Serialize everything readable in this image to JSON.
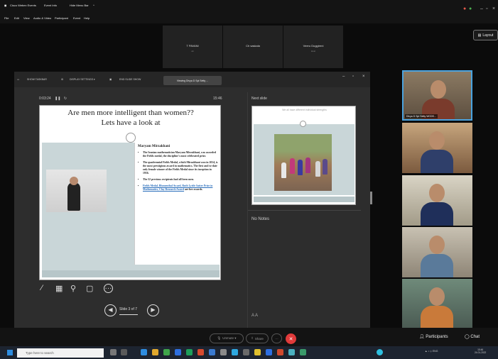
{
  "titlebar": {
    "items": [
      "Cisco Webex Events",
      "Event Info",
      "Hide Menu Bar"
    ],
    "chevron": "^"
  },
  "menubar": {
    "items": [
      "File",
      "Edit",
      "View",
      "Audio & Video",
      "Participant",
      "Event",
      "Help"
    ]
  },
  "participants_strip": [
    {
      "name": "T PAVANI",
      "sub": "ok"
    },
    {
      "name": "Ch saskala",
      "sub": ""
    },
    {
      "name": "Veeru Duggireni",
      "sub": "Host"
    }
  ],
  "layout_button": "Layout",
  "presenter_toolbar": {
    "show_taskbar": "SHOW TASKBAR",
    "display_settings": "DISPLAY SETTINGS ▾",
    "end_slide_show": "END SLIDE SHOW",
    "viewing": "Viewing Divya D Spl Setty ..."
  },
  "timer": "0:03:24",
  "clock": "15:46",
  "slide": {
    "title_line1": "Are men more intelligent than women??",
    "title_line2": "Lets have a look at",
    "subheading": "Maryam Mirzakhani",
    "bullets": [
      "The Iranian mathematician Maryam Mirzakhani, was awarded the Fields medal, the discipline's most celebrated prize.",
      "The quadrennial Fields Medal, which Mirzakhani won in 2014, is the most prestigious award in mathematics. The first and to-date only female winner of the Fields Medal since its inception in 1936.",
      "The 52 previous recipients had all been men."
    ],
    "awards_links": "Fields Medal, Blumenthal Award, Ruth Lyttle Satter Prize in Mathematics, Clay Research Award",
    "awards_tail": "are her awards."
  },
  "next_slide": {
    "label": "Next slide",
    "title": "We all have different individual strengths"
  },
  "notes": "No Notes",
  "notes_controls": "A  A",
  "slide_nav": {
    "counter": "Slide 3 of 7",
    "prev": "◀",
    "next": "▶"
  },
  "gallery": [
    {
      "label": "Divya D Spl Setty WCDS..."
    }
  ],
  "bottom_controls": {
    "unmute": "Unmute ▾",
    "share": "Share",
    "more": "···",
    "end": "✕",
    "participants": "Participants",
    "chat": "Chat"
  },
  "taskbar": {
    "search_placeholder": "Type here to search",
    "tray": "ENG",
    "time": "15:46",
    "date": "24-01-2022"
  },
  "colors": {
    "end_button": "#e03a3a",
    "accent_link": "#2a6ebb",
    "slide_teal": "#c9d6d8"
  }
}
